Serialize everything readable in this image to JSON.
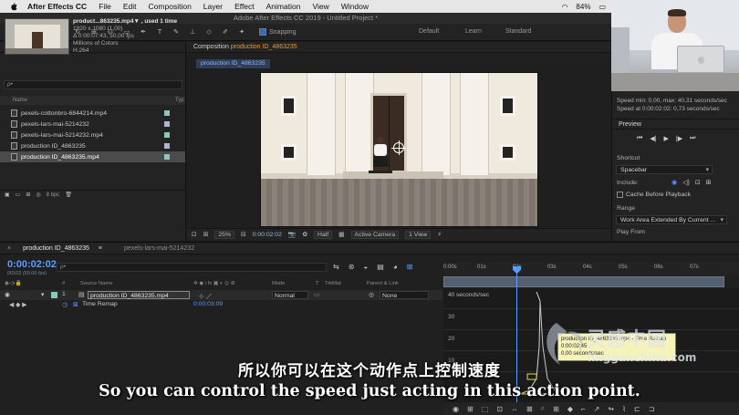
{
  "menubar": {
    "app": "After Effects CC",
    "items": [
      "File",
      "Edit",
      "Composition",
      "Layer",
      "Effect",
      "Animation",
      "View",
      "Window"
    ],
    "battery": "84%"
  },
  "titlebar": {
    "title": "Adobe After Effects CC 2019 - Untitled Project *"
  },
  "toolbar": {
    "snapping_label": "Snapping",
    "workspaces": [
      "Default",
      "Learn",
      "Standard"
    ]
  },
  "project": {
    "tab_label": "Project",
    "selected_file": {
      "name_line": "product...863235.mp4▼ , used 1 time",
      "resolution": "1920 x 1080 (1,00)",
      "duration": "Δ 0:00:07:43, 50,00 fps",
      "colors": "Millions of Colors",
      "codec": "H.264"
    },
    "search_placeholder": "ρ•",
    "column_name": "Name",
    "column_type": "Typ",
    "files": [
      {
        "name": "pexels-cottonbro-6844214.mp4"
      },
      {
        "name": "pexels-lars-mai-5214232"
      },
      {
        "name": "pexels-lars-mai-5214232.mp4"
      },
      {
        "name": "production ID_4863235"
      },
      {
        "name": "production ID_4863235.mp4"
      }
    ],
    "footer_bpc": "8 bpc"
  },
  "composition": {
    "tab_prefix": "Composition",
    "tab_name": "production ID_4863235",
    "sub_tab": "production ID_4863235",
    "zoom": "25%",
    "time": "0:00:02:02",
    "resolution": "Half",
    "camera": "Active Camera",
    "views": "1 View"
  },
  "rightpanel": {
    "speed_min_max": "Speed min: 0,00, max: 40,31 seconds/sec",
    "speed_at": "Speed at 0:00:02:02: 0,73 seconds/sec",
    "preview_label": "Preview",
    "shortcut_label": "Shortcut",
    "shortcut_value": "Spacebar",
    "include_label": "Include:",
    "cache_label": "Cache Before Playback",
    "range_label": "Range",
    "range_value": "Work Area Extended By Current ...",
    "play_from_label": "Play From"
  },
  "timeline": {
    "tab_active": "production ID_4863235",
    "tab_inactive": "pexels-lars-mai-5214232",
    "timecode": "0:00:02:02",
    "fps_line": "00102 (50.00 fps)",
    "search_placeholder": "ρ•",
    "header": {
      "num": "#",
      "source": "Source Name",
      "mode": "Mode",
      "t": "T",
      "trkmat": "TrkMat",
      "parent": "Parent & Link"
    },
    "layer": {
      "num": "1",
      "name": "production ID_4863235.mp4",
      "mode": "Normal",
      "parent": "None"
    },
    "remap": {
      "name": "Time Remap",
      "value": "0:00:03:09"
    },
    "ruler_ticks": [
      "0:00s",
      "01s",
      "02s",
      "03s",
      "04s",
      "05s",
      "06s",
      "07s"
    ],
    "graph_label": "40 seconds/sec",
    "graph_y_labels": [
      "30",
      "20",
      "10"
    ],
    "tooltip": {
      "line1": "production ID_4863235.mp4 - Time Remap",
      "line2": "0:00:02:45",
      "line3": "0,00 seconds/sec"
    }
  },
  "watermark": {
    "cn": "灵感中国",
    "url": "lingganchina.com"
  },
  "subtitles": {
    "cn": "所以你可以在这个动作点上控制速度",
    "en": "So you can control the speed just acting in this action point."
  }
}
